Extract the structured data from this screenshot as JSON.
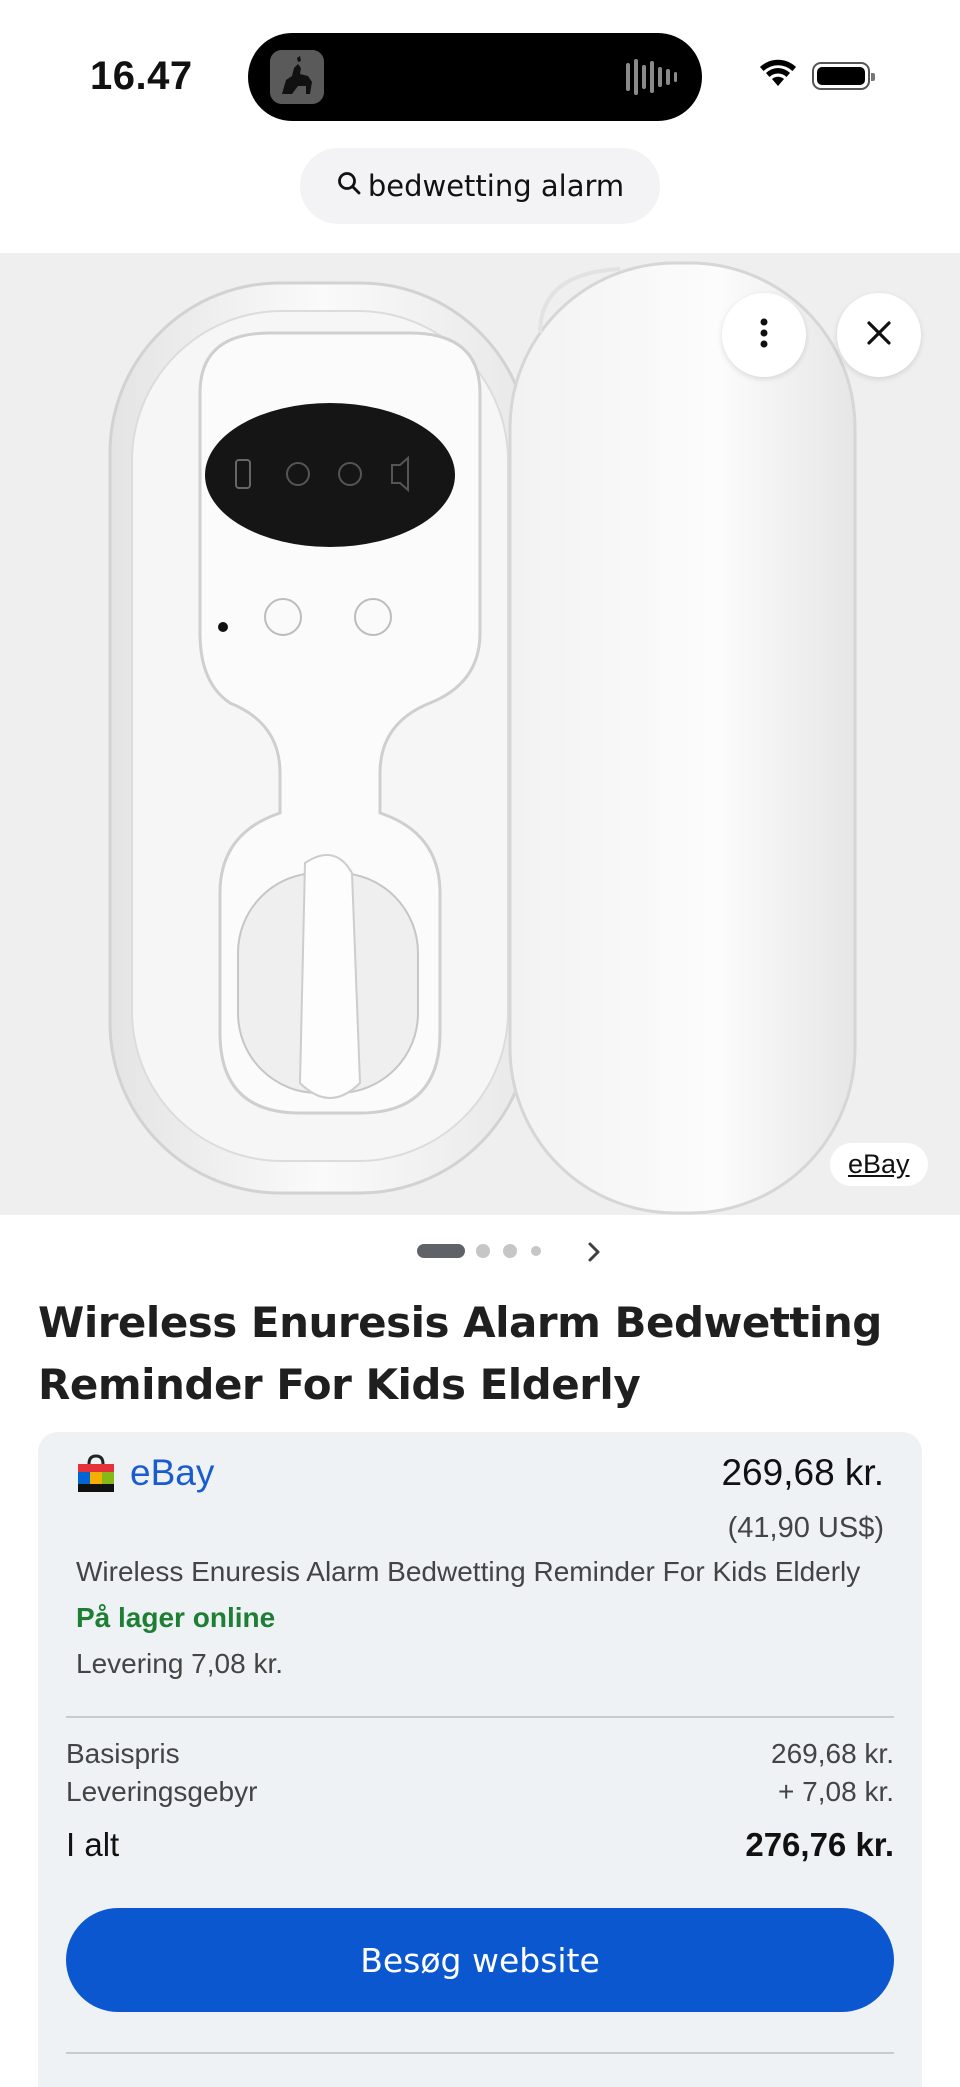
{
  "status_bar": {
    "time": "16.47",
    "wifi_icon": "wifi-icon",
    "battery_icon": "battery-icon"
  },
  "search": {
    "query": "bedwetting alarm",
    "icon": "search-icon"
  },
  "image_viewer": {
    "more_icon": "more-vert-icon",
    "close_icon": "close-icon",
    "source_label": "eBay",
    "page_count": 4,
    "current_page": 1,
    "next_icon": "chevron-right-icon"
  },
  "product": {
    "title": "Wireless Enuresis Alarm Bedwetting Reminder For Kids Elderly"
  },
  "offer": {
    "merchant": "eBay",
    "price": "269,68 kr.",
    "price_usd": "(41,90 US$)",
    "description": "Wireless Enuresis Alarm Bedwetting Reminder For Kids Elderly",
    "stock": "På lager online",
    "delivery": "Levering 7,08 kr.",
    "base_label": "Basispris",
    "base_value": "269,68 kr.",
    "fee_label": "Leveringsgebyr",
    "fee_value": "+ 7,08 kr.",
    "total_label": "I alt",
    "total_value": "276,76 kr.",
    "visit_label": "Besøg website"
  },
  "colors": {
    "accent": "#0b57d0",
    "merchant_link": "#1a5ccf",
    "in_stock": "#1e7e34",
    "card_bg": "#eef2f5"
  }
}
